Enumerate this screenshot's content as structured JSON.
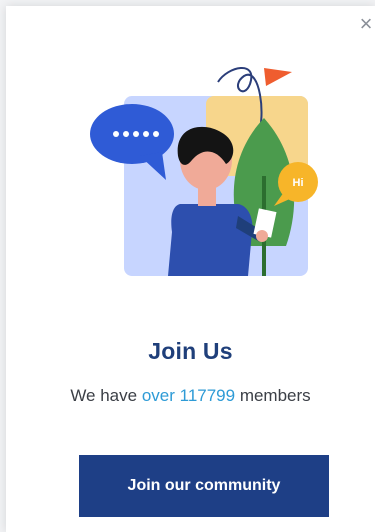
{
  "modal": {
    "close_label": "×",
    "title": "Join Us",
    "subtitle_prefix": "We have ",
    "subtitle_accent": "over 117799",
    "subtitle_suffix": " members",
    "cta_label": "Join our community",
    "speech_bubble_text": "Hi"
  },
  "colors": {
    "title": "#1f3f7a",
    "accent": "#2e9bd6",
    "button_bg": "#1e3f86"
  }
}
